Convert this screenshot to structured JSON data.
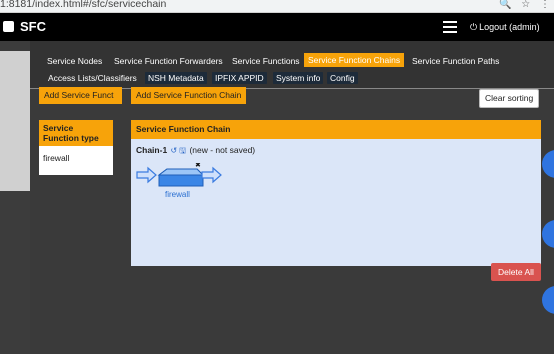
{
  "browser": {
    "url": "1:8181/index.html#/sfc/servicechain"
  },
  "app": {
    "title": "SFC",
    "logout": "Logout (admin)"
  },
  "nav": {
    "row1": [
      "Service Nodes",
      "Service Function Forwarders",
      "Service Functions",
      "Service Function Chains",
      "Service Function Paths"
    ],
    "row2": [
      "Access Lists/Classifiers",
      "NSH Metadata",
      "IPFIX APPID",
      "System info",
      "Config"
    ],
    "active": "Service Function Chains"
  },
  "toolbar": {
    "add_function": "Add Service Funct",
    "add_chain": "Add Service Function Chain",
    "clear_sorting": "Clear sorting"
  },
  "types_panel": {
    "title": "Service Function type",
    "items": [
      "firewall"
    ]
  },
  "chain_panel": {
    "title": "Service Function Chain",
    "chain_name": "Chain-1",
    "status": "(new - not saved)",
    "node_label": "firewall"
  },
  "actions": {
    "delete_all": "Delete All"
  },
  "icons": [
    "lock-icon",
    "star-icon",
    "menu-icon",
    "power-icon",
    "undo-icon",
    "save-icon",
    "close-icon",
    "arrow-right-icon",
    "router-icon"
  ]
}
